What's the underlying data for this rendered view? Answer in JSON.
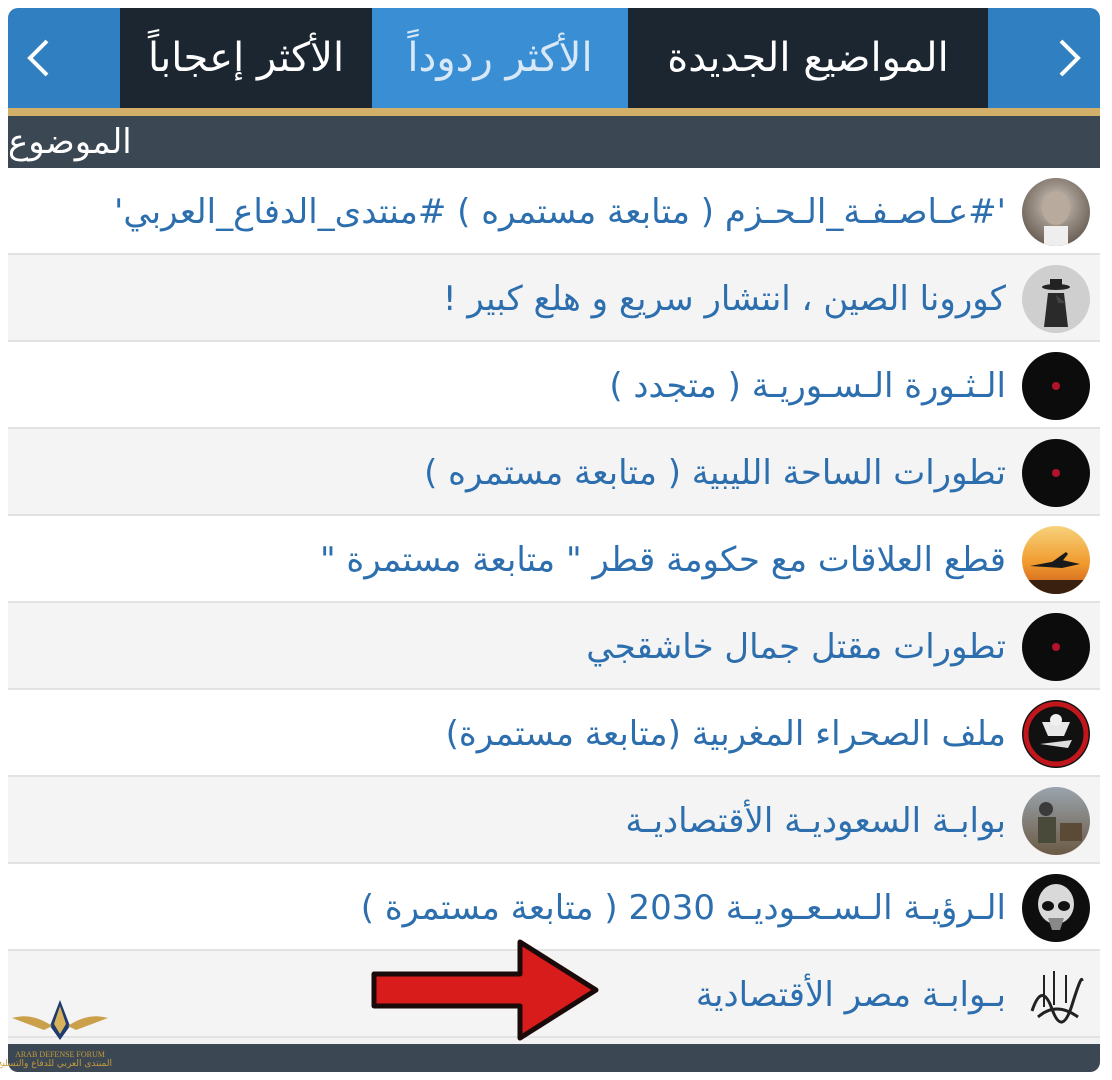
{
  "tabs": {
    "new_topics": "المواضيع الجديدة",
    "most_replied": "الأكثر ردوداً",
    "most_liked": "الأكثر إعجاباً",
    "prev_icon": "chevron-left-icon",
    "next_icon": "chevron-right-icon"
  },
  "header": {
    "topic_label": "الموضوع"
  },
  "topics": [
    {
      "title": "'#عـاصـفـة_الـحـزم ( متابعة مستمره ) #منتدى_الدفاع_العربي'",
      "avatar": "portrait-old-man"
    },
    {
      "title": "كورونا الصين ، انتشار سريع و هلع كبير !",
      "avatar": "plague-doctor"
    },
    {
      "title": "الـثـورة الـسـوريـة ( متجدد )",
      "avatar": "dark-red-dot"
    },
    {
      "title": "تطورات الساحة الليبية ( متابعة مستمره )",
      "avatar": "dark-red-dot"
    },
    {
      "title": "قطع العلاقات مع حكومة قطر \" متابعة مستمرة \"",
      "avatar": "jet-sunset"
    },
    {
      "title": "تطورات مقتل جمال خاشقجي",
      "avatar": "dark-red-dot"
    },
    {
      "title": "ملف الصحراء المغربية (متابعة مستمرة)",
      "avatar": "eagle-emblem"
    },
    {
      "title": "بوابـة السعوديـة الأقتصاديـة",
      "avatar": "soldier-photo"
    },
    {
      "title": "الـرؤيـة الـسـعـوديـة 2030 ( متابعة مستمرة )",
      "avatar": "pilot-helmet"
    },
    {
      "title": "بـوابـة مصر الأقتصادية",
      "avatar": "calligraphy-seal"
    }
  ],
  "watermark": {
    "line1": "ARAB DEFENSE FORUM",
    "line2": "المنتدى العربي للدفاع والتسليح"
  },
  "colors": {
    "accent": "#2f7fc1",
    "gold": "#d2b06a",
    "dark": "#1c2631",
    "link": "#2d6fae",
    "arrow": "#d81b1b"
  }
}
